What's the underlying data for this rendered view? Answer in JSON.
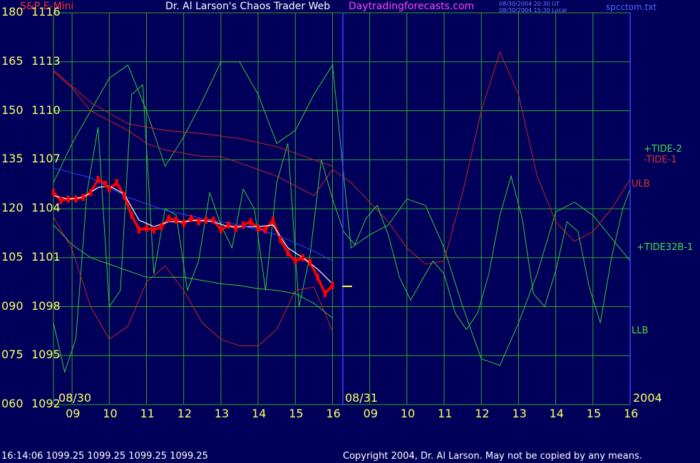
{
  "header": {
    "symbol": "S&P E-Mini",
    "title": "Dr. Al Larson's Chaos Trader Web",
    "site": "Daytradingforecasts.com",
    "timestamp_ut": "08/30/2004 20:30 UT",
    "timestamp_local": "08/30/2004 15:30 Local",
    "filename": "spcctom.txt"
  },
  "footer": {
    "quote": "16:14:06  1099.25 1099.25 1099.25 1099.25",
    "copyright": "Copyright 2004, Dr. Al Larson. May not be copied by any means."
  },
  "colors": {
    "background": "#00005a",
    "grid": "#2aa82a",
    "axis_text": "#ffff66",
    "price": "#ff0000",
    "ema": "#ffffff",
    "tide_green": "#33cc33",
    "tide_red": "#cc2222",
    "trend_blue": "#3344ff"
  },
  "chart_data": {
    "type": "line",
    "title": "S&P E-Mini",
    "xlabel": "",
    "ylabel": "",
    "grid": true,
    "y_left_oscillator": {
      "ticks": [
        "180",
        "165",
        "150",
        "135",
        "120",
        "105",
        "090",
        "075",
        "060"
      ],
      "range": [
        60,
        180
      ]
    },
    "y_left_price": {
      "ticks": [
        "1116",
        "1113",
        "1110",
        "1107",
        "1104",
        "1101",
        "1098",
        "1095",
        "1092"
      ],
      "range": [
        1092,
        1116
      ]
    },
    "x_axis": {
      "hour_ticks": [
        "09",
        "10",
        "11",
        "12",
        "13",
        "14",
        "15",
        "16",
        "09",
        "10",
        "11",
        "12",
        "13",
        "14",
        "15",
        "16"
      ],
      "date_labels": [
        "08/30",
        "08/31"
      ],
      "year_label": "2004"
    },
    "legend_labels": {
      "tide2": "+TIDE-2",
      "tide1": "-TIDE-1",
      "ulb": "ULB",
      "tide32": "+TIDE32B-1",
      "llb": "LLB"
    },
    "series": [
      {
        "name": "Price",
        "color": "#ff0000",
        "x": [
          8.5,
          8.7,
          8.9,
          9.1,
          9.3,
          9.5,
          9.7,
          9.9,
          10.0,
          10.2,
          10.4,
          10.6,
          10.8,
          11.0,
          11.2,
          11.4,
          11.6,
          11.8,
          12.0,
          12.2,
          12.4,
          12.6,
          12.8,
          13.0,
          13.2,
          13.4,
          13.6,
          13.8,
          14.0,
          14.2,
          14.4,
          14.6,
          14.8,
          15.0,
          15.2,
          15.4,
          15.6,
          15.8,
          16.0
        ],
        "y": [
          1105.0,
          1104.5,
          1104.6,
          1104.6,
          1104.7,
          1105.0,
          1105.8,
          1105.5,
          1105.2,
          1105.6,
          1104.8,
          1103.6,
          1102.7,
          1102.8,
          1102.7,
          1102.9,
          1103.4,
          1103.3,
          1103.1,
          1103.4,
          1103.2,
          1103.3,
          1103.3,
          1102.7,
          1103.0,
          1102.8,
          1103.0,
          1103.2,
          1102.8,
          1102.7,
          1103.3,
          1102.1,
          1101.3,
          1100.8,
          1101.0,
          1100.7,
          1099.8,
          1098.8,
          1099.3
        ]
      },
      {
        "name": "EMA",
        "color": "#ffffff",
        "x": [
          8.5,
          8.9,
          9.3,
          9.7,
          10.0,
          10.4,
          10.8,
          11.2,
          11.6,
          12.0,
          12.4,
          12.8,
          13.2,
          13.6,
          14.0,
          14.4,
          14.8,
          15.2,
          15.6,
          16.0
        ],
        "y": [
          1104.8,
          1104.6,
          1104.7,
          1105.3,
          1105.4,
          1104.9,
          1103.3,
          1102.9,
          1103.2,
          1103.2,
          1103.3,
          1103.2,
          1102.9,
          1102.9,
          1102.9,
          1103.0,
          1101.6,
          1101.0,
          1100.3,
          1099.4
        ]
      },
      {
        "name": "Trend",
        "color": "#3344ff",
        "x": [
          8.5,
          9.5,
          10.5,
          11.5,
          12.5,
          13.5,
          14.5,
          15.5,
          16.0
        ],
        "y": [
          1106.5,
          1105.9,
          1104.7,
          1103.9,
          1103.4,
          1103.0,
          1102.4,
          1101.4,
          1100.8
        ]
      },
      {
        "name": "Tide upper band",
        "color": "#cc2222",
        "x": [
          8.5,
          9.5,
          10.5,
          11.5,
          12.5,
          13.5,
          14.5,
          15.5,
          16.0
        ],
        "y": [
          1112.5,
          1110.5,
          1109.2,
          1108.8,
          1108.6,
          1108.3,
          1107.8,
          1107.0,
          1106.6
        ]
      },
      {
        "name": "Tide lower band",
        "color": "#cc2222",
        "x": [
          8.5,
          9.0,
          9.5,
          10.0,
          10.5,
          11.0,
          11.5,
          12.0,
          12.5,
          13.0,
          13.5,
          14.0,
          14.5,
          15.0,
          15.5,
          16.0
        ],
        "y": [
          1103.5,
          1101.5,
          1098.0,
          1096.0,
          1096.8,
          1099.5,
          1100.5,
          1099.0,
          1097.0,
          1096.0,
          1095.6,
          1095.6,
          1096.6,
          1099.0,
          1099.2,
          1096.5
        ]
      },
      {
        "name": "Mid band",
        "color": "#33cc33",
        "x": [
          8.5,
          9.0,
          9.5,
          10.0,
          10.5,
          11.0,
          11.5,
          12.0,
          12.5,
          13.0,
          13.5,
          14.0,
          14.5,
          15.0,
          15.5,
          16.0
        ],
        "y": [
          1103.0,
          1101.8,
          1101.0,
          1100.6,
          1100.2,
          1099.8,
          1099.8,
          1099.8,
          1099.6,
          1099.4,
          1099.3,
          1099.1,
          1099.0,
          1098.8,
          1098.2,
          1097.3
        ]
      }
    ],
    "oscillators": [
      {
        "name": "Tide-2 forecast",
        "color": "#33cc33",
        "x": [
          8.5,
          9.0,
          9.5,
          10.0,
          10.5,
          11.0,
          11.5,
          12.0,
          12.5,
          13.0,
          13.5,
          14.0,
          14.5,
          15.0,
          15.5,
          16.0,
          16.5,
          17.0,
          17.5,
          18.0,
          18.5,
          19.0,
          19.5,
          20.0,
          20.5,
          21.0,
          21.5,
          22.0,
          22.5,
          23.0,
          23.5,
          24.0
        ],
        "y": [
          128,
          140,
          150,
          160,
          164,
          150,
          133,
          142,
          153,
          165,
          165,
          155,
          140,
          144,
          155,
          164,
          108,
          112,
          115,
          123,
          121,
          108,
          90,
          74,
          72,
          85,
          100,
          119,
          122,
          118,
          111,
          104
        ]
      },
      {
        "name": "Tide-1 forecast",
        "color": "#cc2222",
        "x": [
          8.5,
          9.0,
          9.5,
          10.0,
          10.5,
          11.0,
          11.5,
          12.0,
          12.5,
          13.0,
          13.5,
          14.0,
          14.5,
          15.0,
          15.5,
          16.0,
          16.5,
          17.0,
          17.5,
          18.0,
          18.5,
          19.0,
          19.5,
          20.0,
          20.5,
          21.0,
          21.5,
          22.0,
          22.5,
          23.0,
          23.5,
          24.0
        ],
        "y": [
          162,
          157,
          150,
          147,
          144,
          140,
          138,
          137,
          136,
          136,
          134,
          132,
          130,
          127,
          124,
          132,
          128,
          122,
          116,
          108,
          103,
          104,
          125,
          150,
          168,
          155,
          130,
          116,
          110,
          113,
          120,
          129
        ]
      },
      {
        "name": "Tide32B-1 forecast",
        "color": "#33cc33",
        "x": [
          8.5,
          8.8,
          9.1,
          9.4,
          9.7,
          10.0,
          10.3,
          10.6,
          10.9,
          11.2,
          11.5,
          11.8,
          12.1,
          12.4,
          12.7,
          13.0,
          13.3,
          13.6,
          13.9,
          14.2,
          14.5,
          14.8,
          15.1,
          15.4,
          15.7,
          16.0,
          16.3,
          16.6,
          16.9,
          17.2,
          17.5,
          17.8,
          18.1,
          18.4,
          18.7,
          19.0,
          19.3,
          19.6,
          19.9,
          20.2,
          20.5,
          20.8,
          21.1,
          21.4,
          21.7,
          22.0,
          22.3,
          22.6,
          22.9,
          23.2,
          23.5,
          23.8,
          24.0
        ],
        "y": [
          85,
          70,
          80,
          125,
          145,
          90,
          95,
          155,
          158,
          100,
          120,
          118,
          95,
          104,
          125,
          115,
          108,
          126,
          120,
          95,
          128,
          140,
          90,
          106,
          135,
          123,
          113,
          109,
          117,
          121,
          112,
          99,
          92,
          98,
          104,
          100,
          88,
          83,
          88,
          100,
          118,
          130,
          117,
          94,
          90,
          101,
          116,
          113,
          96,
          85,
          105,
          120,
          126
        ]
      }
    ]
  }
}
